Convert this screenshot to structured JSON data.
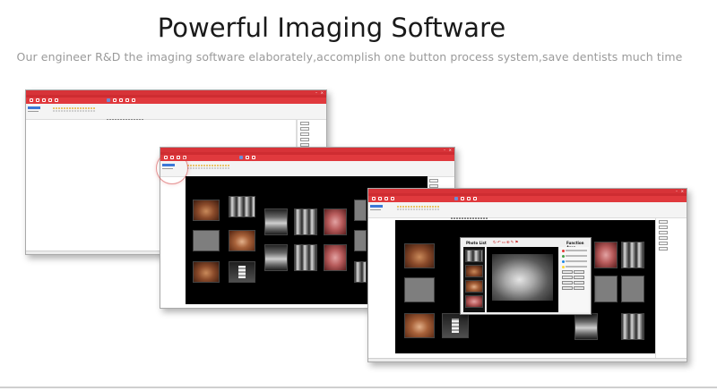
{
  "heading": {
    "title": "Powerful Imaging Software",
    "subtitle": "Our engineer R&D the imaging software elaborately,accomplish one button process system,save dentists much time"
  },
  "screenshots": [
    {
      "name": "dental-software-window-1"
    },
    {
      "name": "dental-software-window-2-photo-grid"
    },
    {
      "name": "dental-software-window-3-photo-list"
    }
  ],
  "dialog": {
    "photo_list_label": "Photo List",
    "function_area_label": "Function Area"
  },
  "colors": {
    "accent_red": "#d73338",
    "background": "#ffffff",
    "title_text": "#1a1a1a",
    "subtitle_text": "#9a9a9a"
  }
}
